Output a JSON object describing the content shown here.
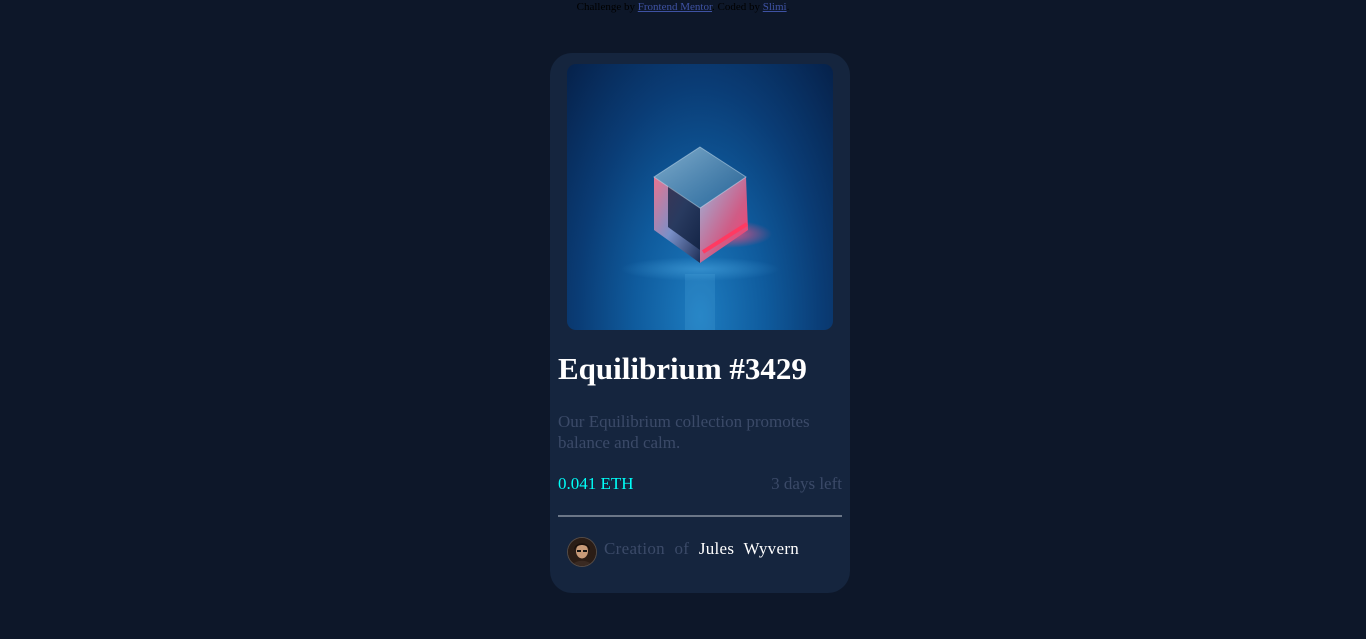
{
  "attribution": {
    "prefix": "Challenge by",
    "mentor_link": "Frontend Mentor",
    "middle": ". Coded by",
    "author_link": "Slimi",
    "suffix": "."
  },
  "card": {
    "image_alt": "Equilibrium cube",
    "title": "Equilibrium #3429",
    "description": "Our Equilibrium collection promotes balance and calm.",
    "price": "0.041 ETH",
    "time_left": "3 days left",
    "creator_prefix": "Creation of",
    "creator_name": "Jules Wyvern"
  },
  "colors": {
    "page_bg": "#0d1729",
    "card_bg": "#15253e",
    "price": "#00fff8",
    "muted_text": "#3b4a68",
    "title": "#ffffff"
  },
  "icons": [
    "eth-icon"
  ]
}
